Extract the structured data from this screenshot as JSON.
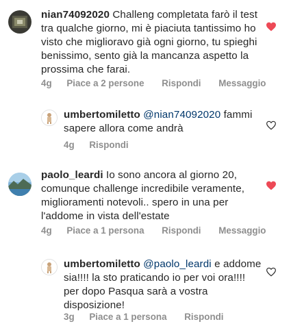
{
  "colors": {
    "text": "#262626",
    "meta": "#8e8e8e",
    "mention": "#00376b",
    "liked_heart": "#ed4956"
  },
  "comments": [
    {
      "username": "nian74092020",
      "text": "Challeng completata farò il test tra qualche giorno, mi è piaciuta tantissimo ho visto che miglioravo già ogni giorno, tu spieghi benissimo, sento già la mancanza aspetto la prossima che farai.",
      "time": "4g",
      "likes": "Piace a 2 persone",
      "reply": "Rispondi",
      "message": "Messaggio",
      "liked": true,
      "heart_icon": "heart-filled-icon",
      "avatar_icon": "user-avatar"
    },
    {
      "username": "umbertomiletto",
      "mention": "@nian74092020",
      "text": "fammi sapere allora come andrà",
      "time": "4g",
      "reply": "Rispondi",
      "liked": false,
      "heart_icon": "heart-outline-icon",
      "avatar_icon": "user-avatar"
    },
    {
      "username": "paolo_leardi",
      "text": "Io sono ancora al giorno 20, comunque challenge incredibile veramente, miglioramenti notevoli.. spero in una per l'addome in vista dell'estate",
      "time": "4g",
      "likes": "Piace a 1 persona",
      "reply": "Rispondi",
      "message": "Messaggio",
      "liked": true,
      "heart_icon": "heart-filled-icon",
      "avatar_icon": "user-avatar"
    },
    {
      "username": "umbertomiletto",
      "mention": "@paolo_leardi",
      "text": "e addome sia!!!! la sto praticando io per voi ora!!!! per dopo Pasqua sarà a vostra disposizione!",
      "time": "3g",
      "likes": "Piace a 1 persona",
      "reply": "Rispondi",
      "liked": false,
      "heart_icon": "heart-outline-icon",
      "avatar_icon": "user-avatar"
    }
  ]
}
